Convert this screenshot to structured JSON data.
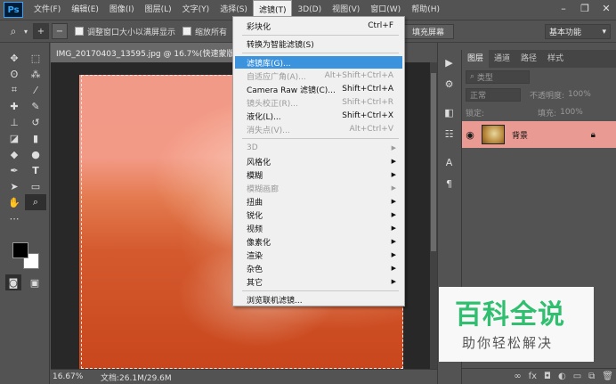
{
  "app": {
    "logo": "Ps",
    "menus": [
      "文件(F)",
      "编辑(E)",
      "图像(I)",
      "图层(L)",
      "文字(Y)",
      "选择(S)",
      "滤镜(T)",
      "3D(D)",
      "视图(V)",
      "窗口(W)",
      "帮助(H)"
    ],
    "active_menu_index": 6
  },
  "options_bar": {
    "checkbox1_label": "调整窗口大小以满屏显示",
    "checkbox2_label": "缩放所有",
    "fill_screen_button": "填充屏幕",
    "workspace_value": "基本功能"
  },
  "document": {
    "tab_title": "IMG_20170403_13595.jpg @ 16.7%(快速蒙版/8) *",
    "close_glyph": "×",
    "zoom": "16.67%",
    "doc_size": "文档:26.1M/29.6M"
  },
  "filter_menu": {
    "items": [
      {
        "label": "彩块化",
        "shortcut": "Ctrl+F",
        "disabled": false,
        "submenu": false
      },
      {
        "label": "转换为智能滤镜(S)",
        "shortcut": "",
        "disabled": false,
        "submenu": false
      },
      {
        "label": "滤镜库(G)...",
        "shortcut": "",
        "disabled": false,
        "submenu": false,
        "highlighted": true
      },
      {
        "label": "自适应广角(A)...",
        "shortcut": "Alt+Shift+Ctrl+A",
        "disabled": true,
        "submenu": false
      },
      {
        "label": "Camera Raw 滤镜(C)...",
        "shortcut": "Shift+Ctrl+A",
        "disabled": false,
        "submenu": false
      },
      {
        "label": "镜头校正(R)...",
        "shortcut": "Shift+Ctrl+R",
        "disabled": true,
        "submenu": false
      },
      {
        "label": "液化(L)...",
        "shortcut": "Shift+Ctrl+X",
        "disabled": false,
        "submenu": false
      },
      {
        "label": "消失点(V)...",
        "shortcut": "Alt+Ctrl+V",
        "disabled": true,
        "submenu": false
      },
      {
        "label": "3D",
        "shortcut": "",
        "disabled": true,
        "submenu": true
      },
      {
        "label": "风格化",
        "shortcut": "",
        "disabled": false,
        "submenu": true
      },
      {
        "label": "模糊",
        "shortcut": "",
        "disabled": false,
        "submenu": true
      },
      {
        "label": "模糊画廊",
        "shortcut": "",
        "disabled": true,
        "submenu": true
      },
      {
        "label": "扭曲",
        "shortcut": "",
        "disabled": false,
        "submenu": true
      },
      {
        "label": "锐化",
        "shortcut": "",
        "disabled": false,
        "submenu": true
      },
      {
        "label": "视频",
        "shortcut": "",
        "disabled": false,
        "submenu": true
      },
      {
        "label": "像素化",
        "shortcut": "",
        "disabled": false,
        "submenu": true
      },
      {
        "label": "渲染",
        "shortcut": "",
        "disabled": false,
        "submenu": true
      },
      {
        "label": "杂色",
        "shortcut": "",
        "disabled": false,
        "submenu": true
      },
      {
        "label": "其它",
        "shortcut": "",
        "disabled": false,
        "submenu": true
      },
      {
        "label": "浏览联机滤镜...",
        "shortcut": "",
        "disabled": false,
        "submenu": false
      }
    ]
  },
  "layers_panel": {
    "tabs": [
      "图层",
      "通道",
      "路径",
      "样式"
    ],
    "kind_placeholder": "类型",
    "blend_mode": "正常",
    "opacity_label": "不透明度:",
    "opacity_value": "100%",
    "lock_label": "锁定:",
    "fill_label": "填充:",
    "fill_value": "100%",
    "layer_name": "背景"
  },
  "watermark": {
    "title": "百科全说",
    "subtitle": "助你轻松解决"
  },
  "colors": {
    "menu_highlight": "#3c93dd",
    "layer_selected": "#e99a93",
    "watermark_green": "#2fbf6f"
  }
}
